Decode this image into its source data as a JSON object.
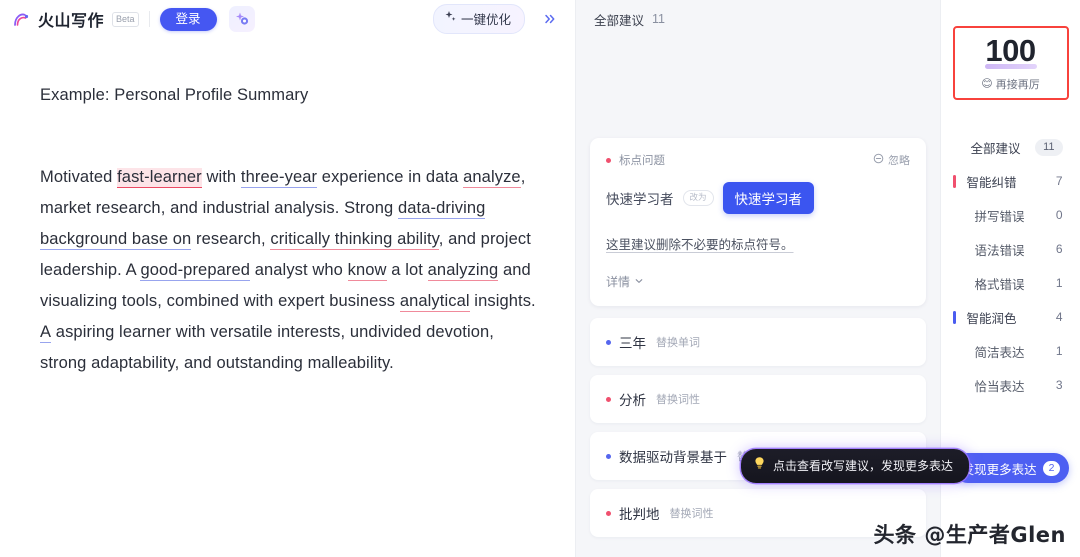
{
  "header": {
    "brand_name": "火山写作",
    "beta_label": "Beta",
    "login_label": "登录",
    "gem_icon": "sparkle-badge-icon",
    "optimize_label": "一键优化",
    "optimize_icon": "sparkle-icon",
    "collapse_icon": "chevron-double-right-icon"
  },
  "document": {
    "title": "Example: Personal Profile Summary",
    "segments": [
      {
        "text": "Motivated ",
        "mark": "none"
      },
      {
        "text": "fast-learner",
        "mark": "red-highlight"
      },
      {
        "text": " with ",
        "mark": "none"
      },
      {
        "text": "three-year",
        "mark": "blue-underline"
      },
      {
        "text": " experience in data ",
        "mark": "none"
      },
      {
        "text": "analyze",
        "mark": "red-underline"
      },
      {
        "text": ", market research, and industrial analysis. Strong ",
        "mark": "none"
      },
      {
        "text": "data-driving background base on",
        "mark": "blue-underline"
      },
      {
        "text": " research, ",
        "mark": "none"
      },
      {
        "text": "critically thinking ability",
        "mark": "red-underline"
      },
      {
        "text": ", and project leadership. A ",
        "mark": "none"
      },
      {
        "text": "good-prepared",
        "mark": "blue-underline"
      },
      {
        "text": " analyst who ",
        "mark": "none"
      },
      {
        "text": "know",
        "mark": "red-underline"
      },
      {
        "text": " a lot ",
        "mark": "none"
      },
      {
        "text": "analyzing",
        "mark": "red-underline"
      },
      {
        "text": " and visualizing tools, combined with expert business ",
        "mark": "none"
      },
      {
        "text": "analytical",
        "mark": "red-underline"
      },
      {
        "text": " insights. ",
        "mark": "none"
      },
      {
        "text": "A",
        "mark": "blue-underline"
      },
      {
        "text": " aspiring learner with versatile interests, undivided devotion, strong adaptability, and outstanding malleability.",
        "mark": "none"
      }
    ]
  },
  "suggestions_panel": {
    "header_label": "全部建议",
    "header_count": "11",
    "active_card": {
      "type_label": "标点问题",
      "ignore_label": "忽略",
      "ignore_icon": "minus-circle-icon",
      "original": "快速学习者",
      "arrow_label": "改为",
      "replacement": "快速学习者",
      "description": "这里建议删除不必要的标点符号。",
      "detail_label": "详情",
      "detail_icon": "chevron-down-icon"
    },
    "rows": [
      {
        "word": "三年",
        "action": "替换单词",
        "dot": "blue"
      },
      {
        "word": "分析",
        "action": "替换词性",
        "dot": "red"
      },
      {
        "word": "数据驱动背景基于",
        "action": "替换词性",
        "dot": "blue"
      },
      {
        "word": "批判地",
        "action": "替换词性",
        "dot": "red"
      }
    ]
  },
  "tooltip": {
    "icon": "lightbulb-icon",
    "text": "点击查看改写建议，发现更多表达"
  },
  "score": {
    "value": "100",
    "caption": "再接再厉",
    "emoji": "😊"
  },
  "sidebar": {
    "all": {
      "label": "全部建议",
      "count": "11"
    },
    "groups": [
      {
        "label": "智能纠错",
        "count": "7",
        "bar": "red",
        "children": [
          {
            "label": "拼写错误",
            "count": "0"
          },
          {
            "label": "语法错误",
            "count": "6"
          },
          {
            "label": "格式错误",
            "count": "1"
          }
        ]
      },
      {
        "label": "智能润色",
        "count": "4",
        "bar": "blue",
        "children": [
          {
            "label": "简洁表达",
            "count": "1"
          },
          {
            "label": "恰当表达",
            "count": "3"
          }
        ]
      }
    ],
    "more_button": {
      "label": "发现更多表达",
      "badge": "2"
    }
  },
  "watermark": {
    "text": "头条 @生产者Glen"
  },
  "colors": {
    "accent_blue": "#4557f2",
    "error_red": "#f0506e",
    "score_border": "#f8423c",
    "panel_bg": "#f5f6f9"
  }
}
